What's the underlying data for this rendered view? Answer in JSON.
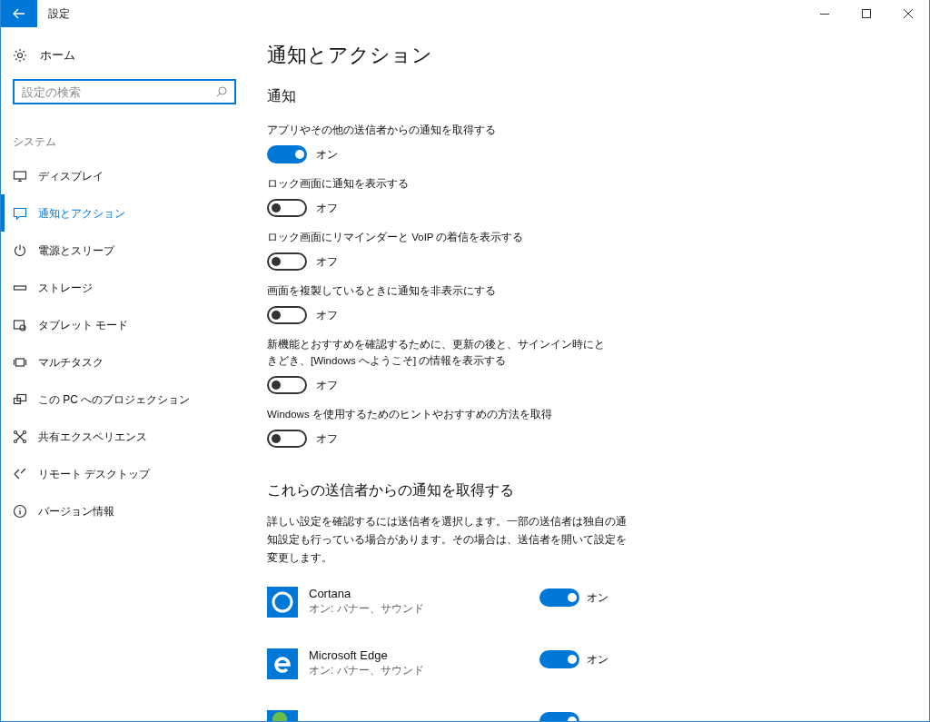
{
  "window": {
    "title": "設定"
  },
  "sidebar": {
    "home": "ホーム",
    "search": {
      "placeholder": "設定の検索"
    },
    "section": "システム",
    "items": [
      {
        "label": "ディスプレイ",
        "kind": "display",
        "selected": false
      },
      {
        "label": "通知とアクション",
        "kind": "notify",
        "selected": true
      },
      {
        "label": "電源とスリープ",
        "kind": "power",
        "selected": false
      },
      {
        "label": "ストレージ",
        "kind": "storage",
        "selected": false
      },
      {
        "label": "タブレット モード",
        "kind": "tablet",
        "selected": false
      },
      {
        "label": "マルチタスク",
        "kind": "multitask",
        "selected": false
      },
      {
        "label": "この PC へのプロジェクション",
        "kind": "project",
        "selected": false
      },
      {
        "label": "共有エクスペリエンス",
        "kind": "share",
        "selected": false
      },
      {
        "label": "リモート デスクトップ",
        "kind": "remote",
        "selected": false
      },
      {
        "label": "バージョン情報",
        "kind": "info",
        "selected": false
      }
    ]
  },
  "page": {
    "title": "通知とアクション",
    "section": "通知",
    "settings": [
      {
        "label": "アプリやその他の送信者からの通知を取得する",
        "on": true,
        "state": "オン"
      },
      {
        "label": "ロック画面に通知を表示する",
        "on": false,
        "state": "オフ"
      },
      {
        "label": "ロック画面にリマインダーと VoIP の着信を表示する",
        "on": false,
        "state": "オフ"
      },
      {
        "label": "画面を複製しているときに通知を非表示にする",
        "on": false,
        "state": "オフ"
      },
      {
        "label": "新機能とおすすめを確認するために、更新の後と、サインイン時にときどき、[Windows へようこそ] の情報を表示する",
        "on": false,
        "state": "オフ"
      },
      {
        "label": "Windows を使用するためのヒントやおすすめの方法を取得",
        "on": false,
        "state": "オフ"
      }
    ],
    "senders_title": "これらの送信者からの通知を取得する",
    "senders_desc": "詳しい設定を確認するには送信者を選択します。一部の送信者は独自の通知設定も行っている場合があります。その場合は、送信者を開いて設定を変更します。",
    "senders": [
      {
        "name": "Cortana",
        "detail": "オン: バナー、サウンド",
        "kind": "cortana",
        "on": true,
        "state": "オン"
      },
      {
        "name": "Microsoft Edge",
        "detail": "オン: バナー、サウンド",
        "kind": "edge",
        "on": true,
        "state": "オン"
      },
      {
        "kind": "ime",
        "on": true
      }
    ]
  }
}
